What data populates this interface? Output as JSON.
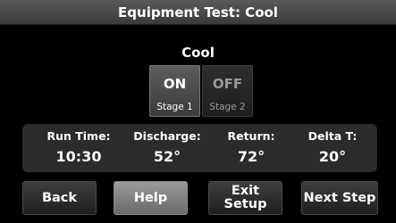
{
  "header": {
    "title": "Equipment Test: Cool"
  },
  "mode": {
    "title": "Cool"
  },
  "toggles": [
    {
      "label": "ON",
      "stage": "Stage 1",
      "active": true
    },
    {
      "label": "OFF",
      "stage": "Stage 2",
      "active": false
    }
  ],
  "readings": [
    {
      "label": "Run Time:",
      "value": "10:30"
    },
    {
      "label": "Discharge:",
      "value": "52°"
    },
    {
      "label": "Return:",
      "value": "72°"
    },
    {
      "label": "Delta T:",
      "value": "20°"
    }
  ],
  "buttons": {
    "back": "Back",
    "help": "Help",
    "exit_line1": "Exit",
    "exit_line2": "Setup",
    "next": "Next Step"
  }
}
